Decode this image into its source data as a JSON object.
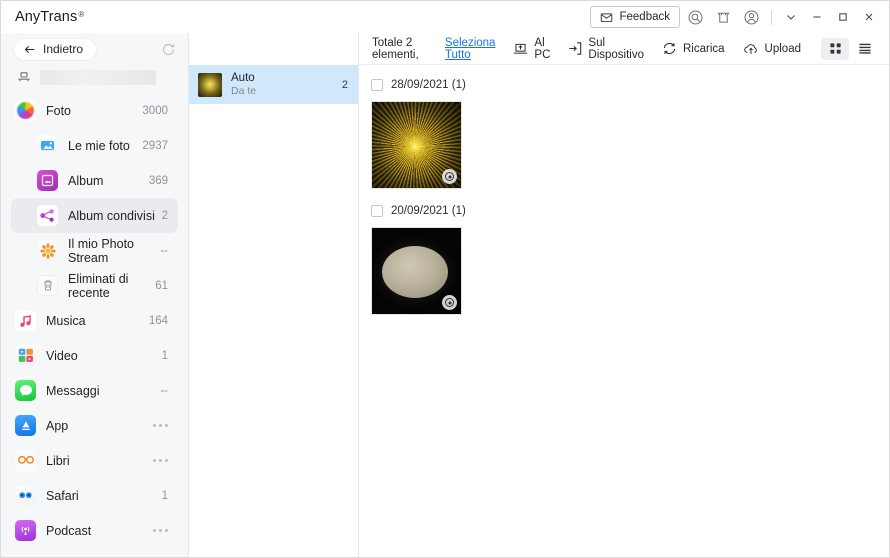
{
  "titlebar": {
    "brand": "AnyTrans",
    "registered": "®",
    "feedback_label": "Feedback",
    "icons": [
      "envelope-icon",
      "search-icon",
      "gift-icon",
      "account-icon"
    ],
    "window_controls": [
      "chevron-down-icon",
      "minimize-icon",
      "maximize-icon",
      "close-icon"
    ]
  },
  "sidebar": {
    "back_label": "Indietro",
    "refresh_icon": "refresh-icon",
    "device_name": "",
    "items": [
      {
        "label": "Foto",
        "count": "3000",
        "icon": "photos-icon",
        "level": "parent",
        "caret": "down",
        "active": false
      },
      {
        "label": "Le mie foto",
        "count": "2937",
        "icon": "my-photos-icon",
        "level": "child",
        "caret": "",
        "active": false
      },
      {
        "label": "Album",
        "count": "369",
        "icon": "album-icon",
        "level": "child",
        "caret": "",
        "active": false
      },
      {
        "label": "Album condivisi",
        "count": "2",
        "icon": "shared-album-icon",
        "level": "child",
        "caret": "",
        "active": true
      },
      {
        "label": "Il mio Photo Stream",
        "count": "--",
        "icon": "photo-stream-icon",
        "level": "child",
        "caret": "",
        "active": false
      },
      {
        "label": "Eliminati di recente",
        "count": "61",
        "icon": "trash-icon",
        "level": "child",
        "caret": "",
        "active": false
      },
      {
        "label": "Musica",
        "count": "164",
        "icon": "music-icon",
        "level": "parent",
        "caret": "right",
        "active": false
      },
      {
        "label": "Video",
        "count": "1",
        "icon": "video-icon",
        "level": "parent",
        "caret": "right",
        "active": false
      },
      {
        "label": "Messaggi",
        "count": "--",
        "icon": "messages-icon",
        "level": "parent",
        "caret": "",
        "active": false
      },
      {
        "label": "App",
        "count": "dots",
        "icon": "app-store-icon",
        "level": "parent",
        "caret": "",
        "active": false
      },
      {
        "label": "Libri",
        "count": "dots",
        "icon": "books-icon",
        "level": "parent",
        "caret": "right",
        "active": false
      },
      {
        "label": "Safari",
        "count": "1",
        "icon": "safari-icon",
        "level": "parent",
        "caret": "right",
        "active": false
      },
      {
        "label": "Podcast",
        "count": "dots",
        "icon": "podcast-icon",
        "level": "parent",
        "caret": "",
        "active": false
      }
    ]
  },
  "album_panel": {
    "albums": [
      {
        "name": "Auto",
        "subtitle": "Da te",
        "count": "2",
        "selected": true
      }
    ]
  },
  "toolbar": {
    "total_text": "Totale 2 elementi,",
    "select_all_label": "Seleziona Tutto",
    "actions": [
      {
        "label": "Al PC",
        "icon": "export-to-pc-icon"
      },
      {
        "label": "Sul Dispositivo",
        "icon": "to-device-icon"
      },
      {
        "label": "Ricarica",
        "icon": "reload-icon"
      },
      {
        "label": "Upload",
        "icon": "upload-cloud-icon"
      }
    ],
    "grid_view_icon": "grid-view-icon",
    "list_view_icon": "list-view-icon",
    "active_view": "grid"
  },
  "photo_groups": [
    {
      "date": "28/09/2021 (1)",
      "photos": [
        {
          "style": "p1",
          "badge": "live-photo-badge"
        }
      ]
    },
    {
      "date": "20/09/2021 (1)",
      "photos": [
        {
          "style": "p2",
          "badge": "live-photo-badge"
        }
      ]
    }
  ],
  "colors": {
    "accent_link": "#1a73e8",
    "selection": "#cfe8fb",
    "sidebar_bg": "#f6f7f9",
    "active_nav": "#eaebee"
  }
}
